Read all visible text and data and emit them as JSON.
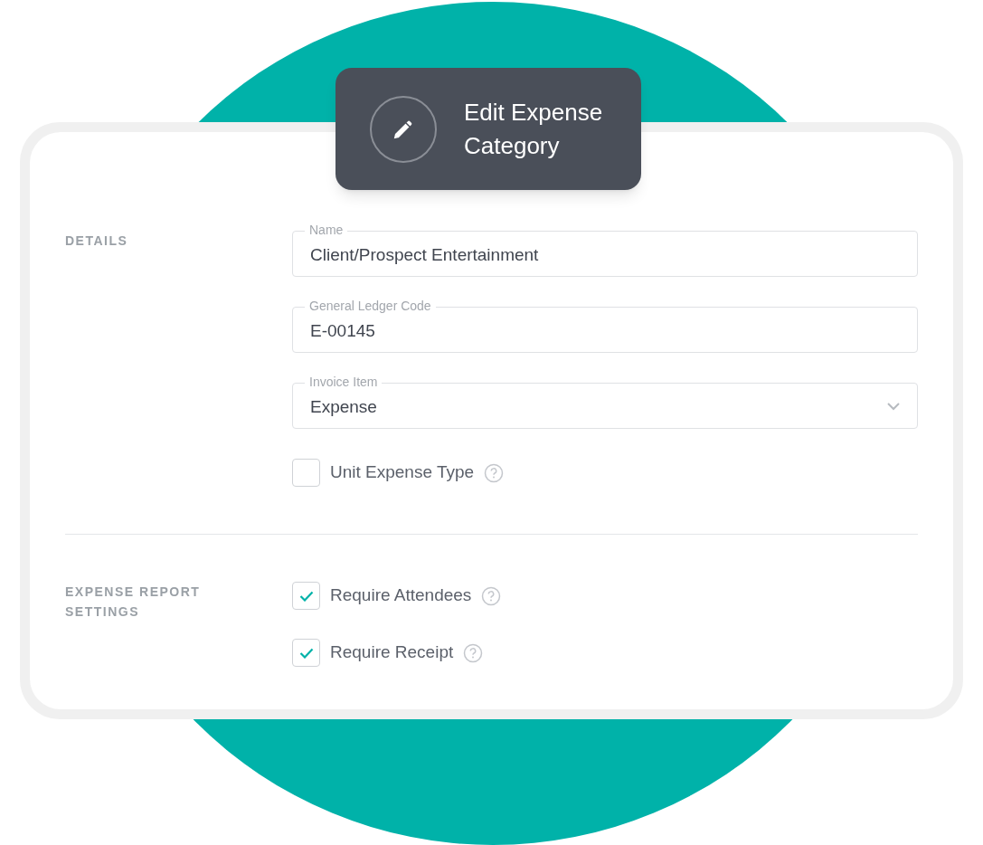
{
  "header": {
    "title": "Edit Expense Category"
  },
  "sections": [
    {
      "label": "DETAILS",
      "items": [
        {
          "kind": "text",
          "label": "Name",
          "value": "Client/Prospect Entertainment"
        },
        {
          "kind": "text",
          "label": "General Ledger Code",
          "value": "E-00145"
        },
        {
          "kind": "select",
          "label": "Invoice Item",
          "value": "Expense"
        },
        {
          "kind": "checkbox",
          "label": "Unit Expense Type",
          "checked": false
        }
      ]
    },
    {
      "label": "EXPENSE REPORT SETTINGS",
      "items": [
        {
          "kind": "checkbox",
          "label": "Require Attendees",
          "checked": true
        },
        {
          "kind": "checkbox",
          "label": "Require Receipt",
          "checked": true
        }
      ]
    }
  ]
}
